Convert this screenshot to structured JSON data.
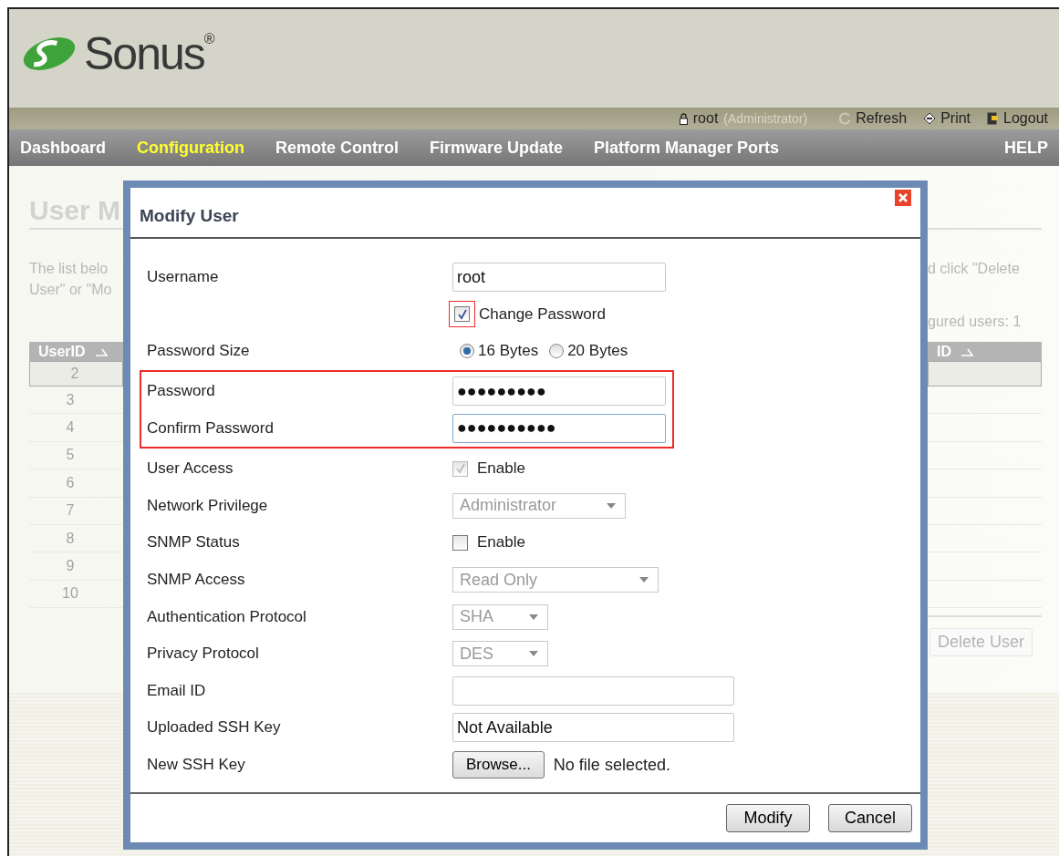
{
  "header": {
    "logo": "Sonus$^{®}$"
  },
  "user_bar": {
    "user": "root",
    "role": "(Administrator)",
    "links": [
      {
        "kind": "refresh",
        "label": "Refresh"
      },
      {
        "kind": "print",
        "label": "Print"
      },
      {
        "kind": "logout",
        "label": "Logout"
      }
    ]
  },
  "nav": {
    "items": [
      {
        "label": "Dashboard",
        "selected": false
      },
      {
        "label": "Configuration",
        "selected": true
      },
      {
        "label": "Remote Control",
        "selected": false
      },
      {
        "label": "Firmware Update",
        "selected": false
      },
      {
        "label": "Platform Manager Ports",
        "selected": false
      }
    ],
    "help": "HELP"
  },
  "background": {
    "title": "User M",
    "intro_left": [
      "The list belo",
      "User\" or \"Mo"
    ],
    "intro_right": "d click \"Delete",
    "count": "gured users: 1",
    "left_header": "UserID",
    "right_header": "ID",
    "rows": [
      {
        "id": "2",
        "selected": true
      },
      {
        "id": "3",
        "selected": false
      },
      {
        "id": "4",
        "selected": false
      },
      {
        "id": "5",
        "selected": false
      },
      {
        "id": "6",
        "selected": false
      },
      {
        "id": "7",
        "selected": false
      },
      {
        "id": "8",
        "selected": false
      },
      {
        "id": "9",
        "selected": false
      },
      {
        "id": "10",
        "selected": false
      }
    ],
    "delete_button": "Delete User"
  },
  "dialog": {
    "title": "Modify User",
    "sections": [
      {
        "highlighted": false,
        "fields": [
          {
            "kind": "text",
            "label": "Username",
            "value": "root"
          },
          {
            "kind": "checkbox",
            "option": "Change Password",
            "checked": true,
            "disabled": false,
            "highlighted": true
          },
          {
            "kind": "radio",
            "label": "Password Size",
            "options": [
              {
                "label": "16 Bytes",
                "selected": true
              },
              {
                "label": "20 Bytes",
                "selected": false
              }
            ]
          }
        ]
      },
      {
        "highlighted": true,
        "fields": [
          {
            "kind": "password",
            "label": "Password",
            "value": "●●●●●●●●●",
            "focused": false
          },
          {
            "kind": "password",
            "label": "Confirm Password",
            "value": "●●●●●●●●●●",
            "focused": true
          }
        ]
      },
      {
        "highlighted": false,
        "fields": [
          {
            "kind": "checkbox",
            "label": "User Access",
            "option": "Enable",
            "checked": true,
            "disabled": true,
            "highlighted": false
          },
          {
            "kind": "select",
            "label": "Network Privilege",
            "value": "Administrator",
            "disabled": true
          },
          {
            "kind": "checkbox",
            "label": "SNMP Status",
            "option": "Enable",
            "checked": false,
            "disabled": false,
            "highlighted": false
          },
          {
            "kind": "select",
            "label": "SNMP Access",
            "value": "Read Only",
            "disabled": true
          },
          {
            "kind": "select",
            "label": "Authentication Protocol",
            "value": "SHA",
            "disabled": true
          },
          {
            "kind": "select",
            "label": "Privacy Protocol",
            "value": "DES",
            "disabled": true
          },
          {
            "kind": "text",
            "label": "Email ID"
          },
          {
            "kind": "text",
            "label": "Uploaded SSH Key",
            "value": "Not Available"
          },
          {
            "kind": "file",
            "label": "New SSH Key",
            "button": "Browse...",
            "status": "No file selected."
          }
        ]
      }
    ]
  },
  "buttons": [
    "Modify",
    "Cancel"
  ]
}
